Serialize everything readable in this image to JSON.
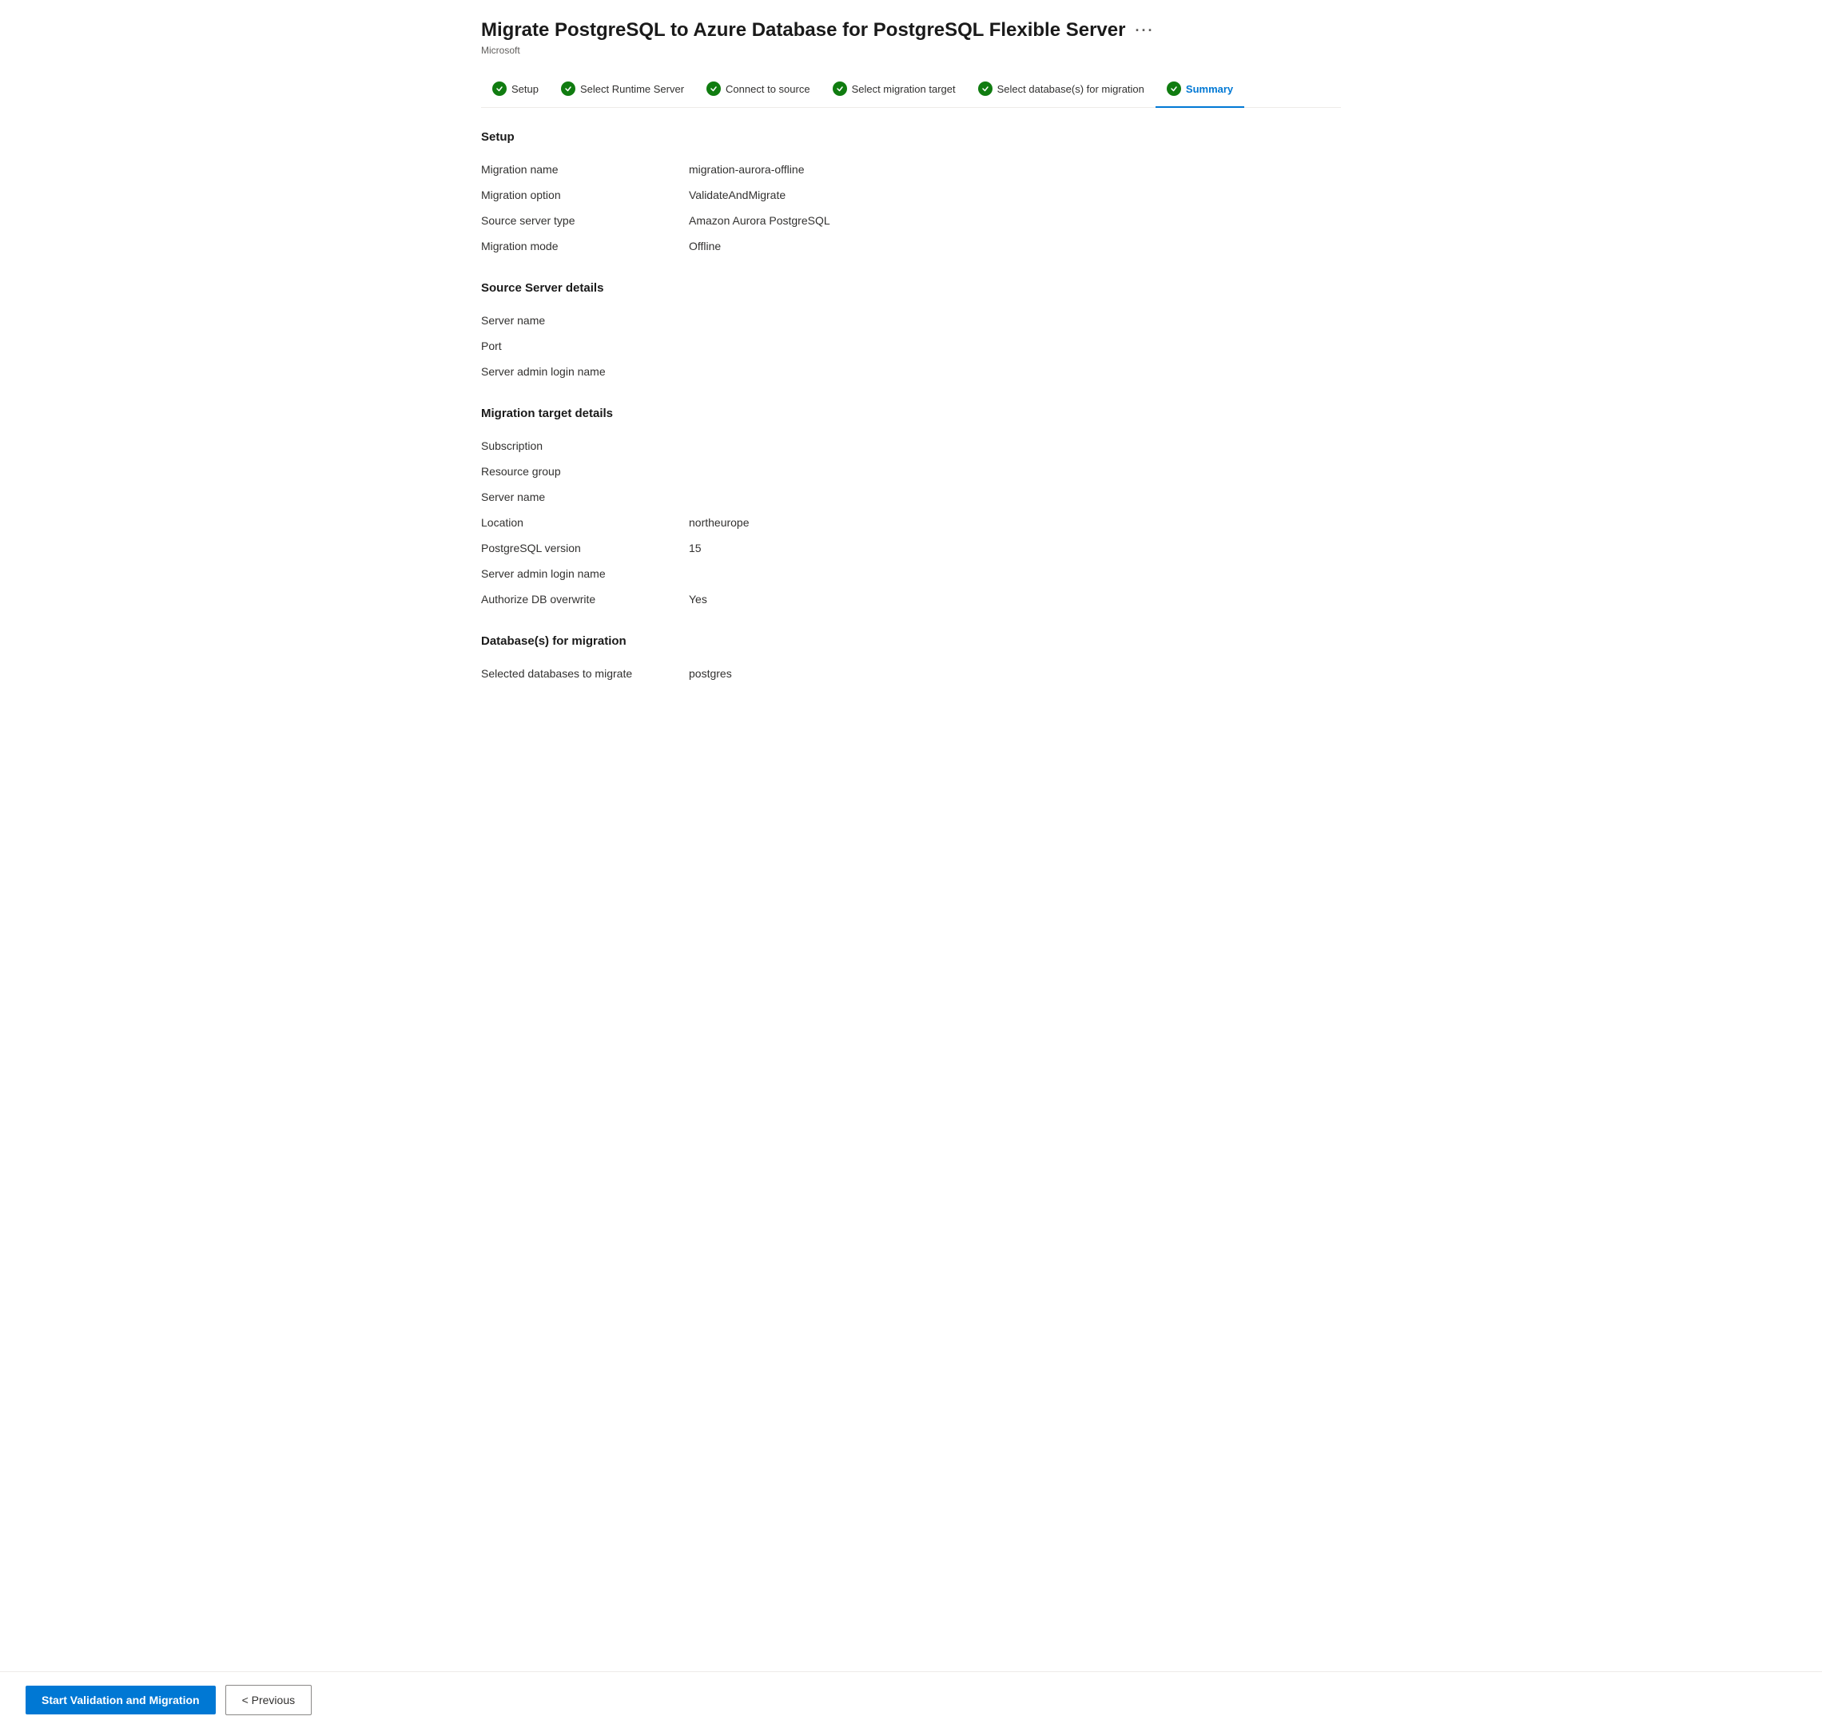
{
  "header": {
    "title": "Migrate PostgreSQL to Azure Database for PostgreSQL Flexible Server",
    "publisher": "Microsoft",
    "ellipsis": "···"
  },
  "steps": [
    {
      "id": "setup",
      "label": "Setup",
      "completed": true,
      "active": false
    },
    {
      "id": "runtime",
      "label": "Select Runtime Server",
      "completed": true,
      "active": false
    },
    {
      "id": "source",
      "label": "Connect to source",
      "completed": true,
      "active": false
    },
    {
      "id": "target",
      "label": "Select migration target",
      "completed": true,
      "active": false
    },
    {
      "id": "databases",
      "label": "Select database(s) for migration",
      "completed": true,
      "active": false
    },
    {
      "id": "summary",
      "label": "Summary",
      "completed": true,
      "active": true
    }
  ],
  "sections": {
    "setup": {
      "header": "Setup",
      "rows": [
        {
          "label": "Migration name",
          "value": "migration-aurora-offline"
        },
        {
          "label": "Migration option",
          "value": "ValidateAndMigrate"
        },
        {
          "label": "Source server type",
          "value": "Amazon Aurora PostgreSQL"
        },
        {
          "label": "Migration mode",
          "value": "Offline"
        }
      ]
    },
    "sourceServer": {
      "header": "Source Server details",
      "rows": [
        {
          "label": "Server name",
          "value": ""
        },
        {
          "label": "Port",
          "value": ""
        },
        {
          "label": "Server admin login name",
          "value": ""
        }
      ]
    },
    "migrationTarget": {
      "header": "Migration target details",
      "rows": [
        {
          "label": "Subscription",
          "value": ""
        },
        {
          "label": "Resource group",
          "value": ""
        },
        {
          "label": "Server name",
          "value": ""
        },
        {
          "label": "Location",
          "value": "northeurope"
        },
        {
          "label": "PostgreSQL version",
          "value": "15"
        },
        {
          "label": "Server admin login name",
          "value": ""
        },
        {
          "label": "Authorize DB overwrite",
          "value": "Yes"
        }
      ]
    },
    "databases": {
      "header": "Database(s) for migration",
      "rows": [
        {
          "label": "Selected databases to migrate",
          "value": "postgres"
        }
      ]
    }
  },
  "footer": {
    "start_button": "Start Validation and Migration",
    "previous_button": "< Previous"
  }
}
